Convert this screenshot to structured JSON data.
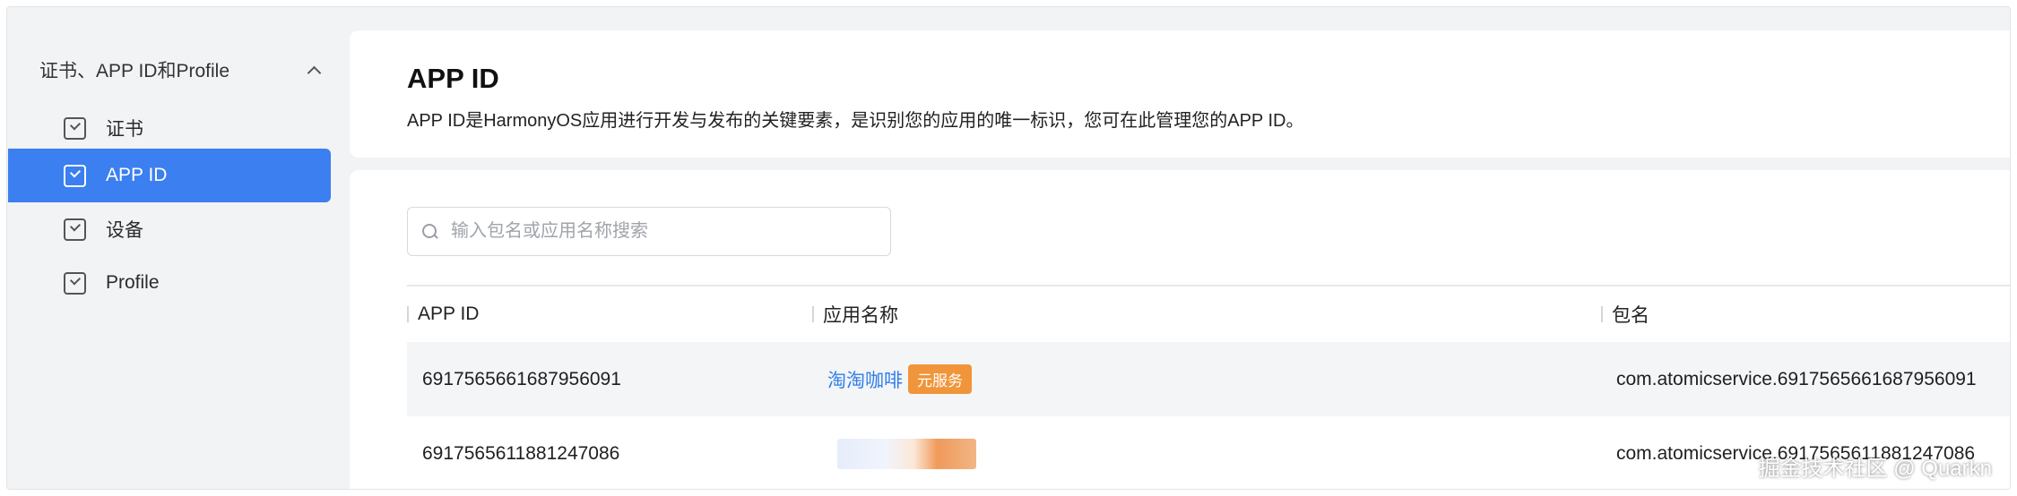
{
  "sidebar": {
    "group_label": "证书、APP ID和Profile",
    "items": [
      {
        "label": "证书",
        "icon": "certificate-icon"
      },
      {
        "label": "APP ID",
        "icon": "app-id-icon",
        "active": true
      },
      {
        "label": "设备",
        "icon": "device-icon"
      },
      {
        "label": "Profile",
        "icon": "profile-icon"
      }
    ]
  },
  "header": {
    "title": "APP ID",
    "description": "APP ID是HarmonyOS应用进行开发与发布的关键要素，是识别您的应用的唯一标识，您可在此管理您的APP ID。"
  },
  "search": {
    "placeholder": "输入包名或应用名称搜索",
    "value": ""
  },
  "table": {
    "columns": [
      "APP ID",
      "应用名称",
      "包名"
    ],
    "rows": [
      {
        "app_id": "6917565661687956091",
        "app_name": "淘淘咖啡",
        "badge": "元服务",
        "package": "com.atomicservice.6917565661687956091"
      },
      {
        "app_id": "6917565611881247086",
        "app_name": "",
        "package": "com.atomicservice.6917565611881247086"
      }
    ]
  },
  "watermark": "掘金技术社区 @ Quarkn",
  "colors": {
    "accent": "#3b7ff0",
    "link": "#2f7ee8",
    "badge": "#f0953a",
    "background": "#f1f3f5"
  }
}
